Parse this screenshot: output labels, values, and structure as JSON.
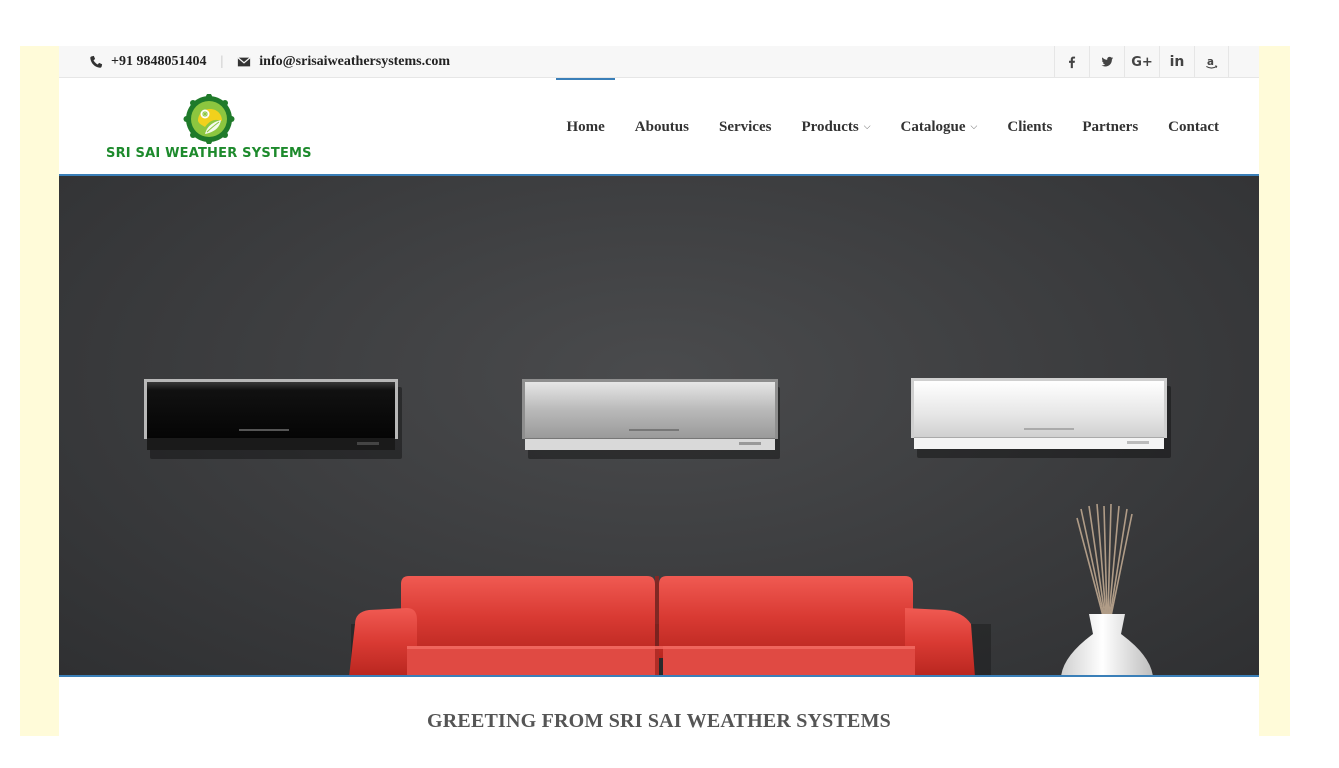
{
  "topbar": {
    "phone": "+91 9848051404",
    "email": "info@srisaiweathersystems.com",
    "phone_icon": "phone-icon",
    "email_icon": "envelope-icon",
    "social": [
      {
        "name": "facebook-icon",
        "glyph": "f"
      },
      {
        "name": "twitter-icon",
        "glyph": "🐦"
      },
      {
        "name": "google-plus-icon",
        "glyph": "G+"
      },
      {
        "name": "linkedin-icon",
        "glyph": "in"
      },
      {
        "name": "amazon-icon",
        "glyph": "a"
      }
    ]
  },
  "brand": {
    "name": "SRI SAI WEATHER SYSTEMS",
    "color": "#1d8a2c"
  },
  "nav": {
    "home": "Home",
    "aboutus": "Aboutus",
    "services": "Services",
    "products": "Products",
    "catalogue": "Catalogue",
    "clients": "Clients",
    "partners": "Partners",
    "contact": "Contact",
    "active": "Home",
    "accent": "#3a7fb8"
  },
  "hero": {
    "description_items": [
      "black-ac-unit",
      "silver-ac-unit",
      "white-ac-unit",
      "red-sofa",
      "white-vase"
    ]
  },
  "greeting": {
    "title": "GREETING FROM SRI SAI WEATHER SYSTEMS"
  }
}
